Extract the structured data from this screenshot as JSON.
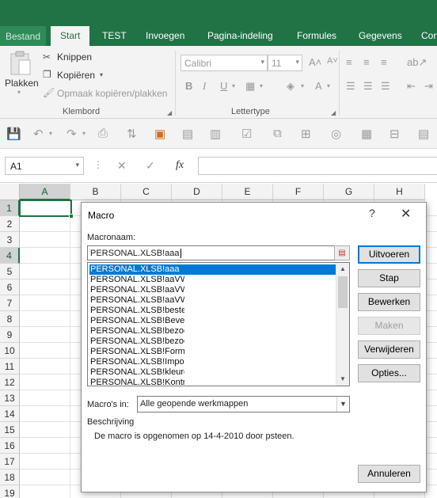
{
  "ribbon_tabs": [
    {
      "label": "Bestand"
    },
    {
      "label": "Start"
    },
    {
      "label": "TEST"
    },
    {
      "label": "Invoegen"
    },
    {
      "label": "Pagina-indeling"
    },
    {
      "label": "Formules"
    },
    {
      "label": "Gegevens"
    },
    {
      "label": "Con"
    }
  ],
  "clipboard": {
    "paste": "Plakken",
    "cut": "Knippen",
    "copy": "Kopiëren",
    "format_painter": "Opmaak kopiëren/plakken",
    "group": "Klembord"
  },
  "font": {
    "name": "Calibri",
    "size": "11",
    "bold": "B",
    "italic": "I",
    "underline": "U",
    "grow": "A",
    "group": "Lettertype"
  },
  "formula_bar": {
    "name_box": "A1",
    "fx": "fx",
    "cancel": "✕",
    "enter": "✓"
  },
  "columns": [
    "A",
    "B",
    "C",
    "D",
    "E",
    "F",
    "G",
    "H"
  ],
  "rows": [
    "1",
    "2",
    "3",
    "4",
    "5",
    "6",
    "7",
    "8",
    "9",
    "10",
    "11",
    "12",
    "13",
    "14",
    "15",
    "16",
    "17",
    "18",
    "19"
  ],
  "dialog": {
    "title": "Macro",
    "help": "?",
    "close": "✕",
    "name_label": "Macronaam:",
    "name_value": "PERSONAL.XLSB!aaa",
    "macros": [
      "PERSONAL.XLSB!aaa",
      "PERSONAL.XLSB!aaVW_",
      "PERSONAL.XLSB!aaVW_",
      "PERSONAL.XLSB!aaVW_",
      "PERSONAL.XLSB!bestek",
      "PERSONAL.XLSB!Beveilig",
      "PERSONAL.XLSB!bezoek",
      "PERSONAL.XLSB!bezoek",
      "PERSONAL.XLSB!Formul",
      "PERSONAL.XLSB!Import",
      "PERSONAL.XLSB!kleurcc",
      "PERSONAL.XLSB!Kontral"
    ],
    "buttons": {
      "run": "Uitvoeren",
      "step": "Stap",
      "edit": "Bewerken",
      "create": "Maken",
      "delete": "Verwijderen",
      "options": "Opties...",
      "cancel": "Annuleren"
    },
    "macros_in_label": "Macro's in:",
    "macros_in_value": "Alle geopende werkmappen",
    "description_label": "Beschrijving",
    "description_text": "De macro is opgenomen op 14-4-2010 door psteen."
  },
  "colors": {
    "excel_green": "#217346",
    "selection_blue": "#0078d7"
  }
}
